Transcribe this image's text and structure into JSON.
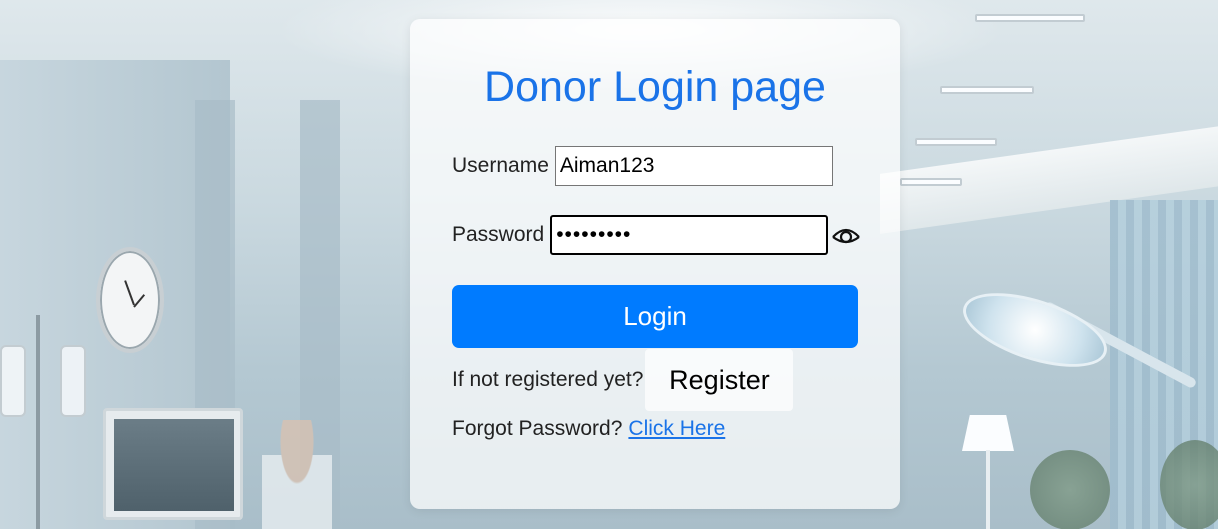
{
  "page": {
    "title": "Donor Login page"
  },
  "form": {
    "username_label": "Username",
    "username_value": "Aiman123",
    "password_label": "Password",
    "password_value": "password1",
    "login_label": "Login",
    "register_prompt": "If not registered yet?",
    "register_label": "Register",
    "forgot_prompt": "Forgot Password?",
    "forgot_link": "Click Here"
  },
  "icons": {
    "password_toggle": "eye-icon"
  },
  "colors": {
    "title": "#1a73e8",
    "login_button": "#007bff",
    "link": "#1a73e8"
  }
}
